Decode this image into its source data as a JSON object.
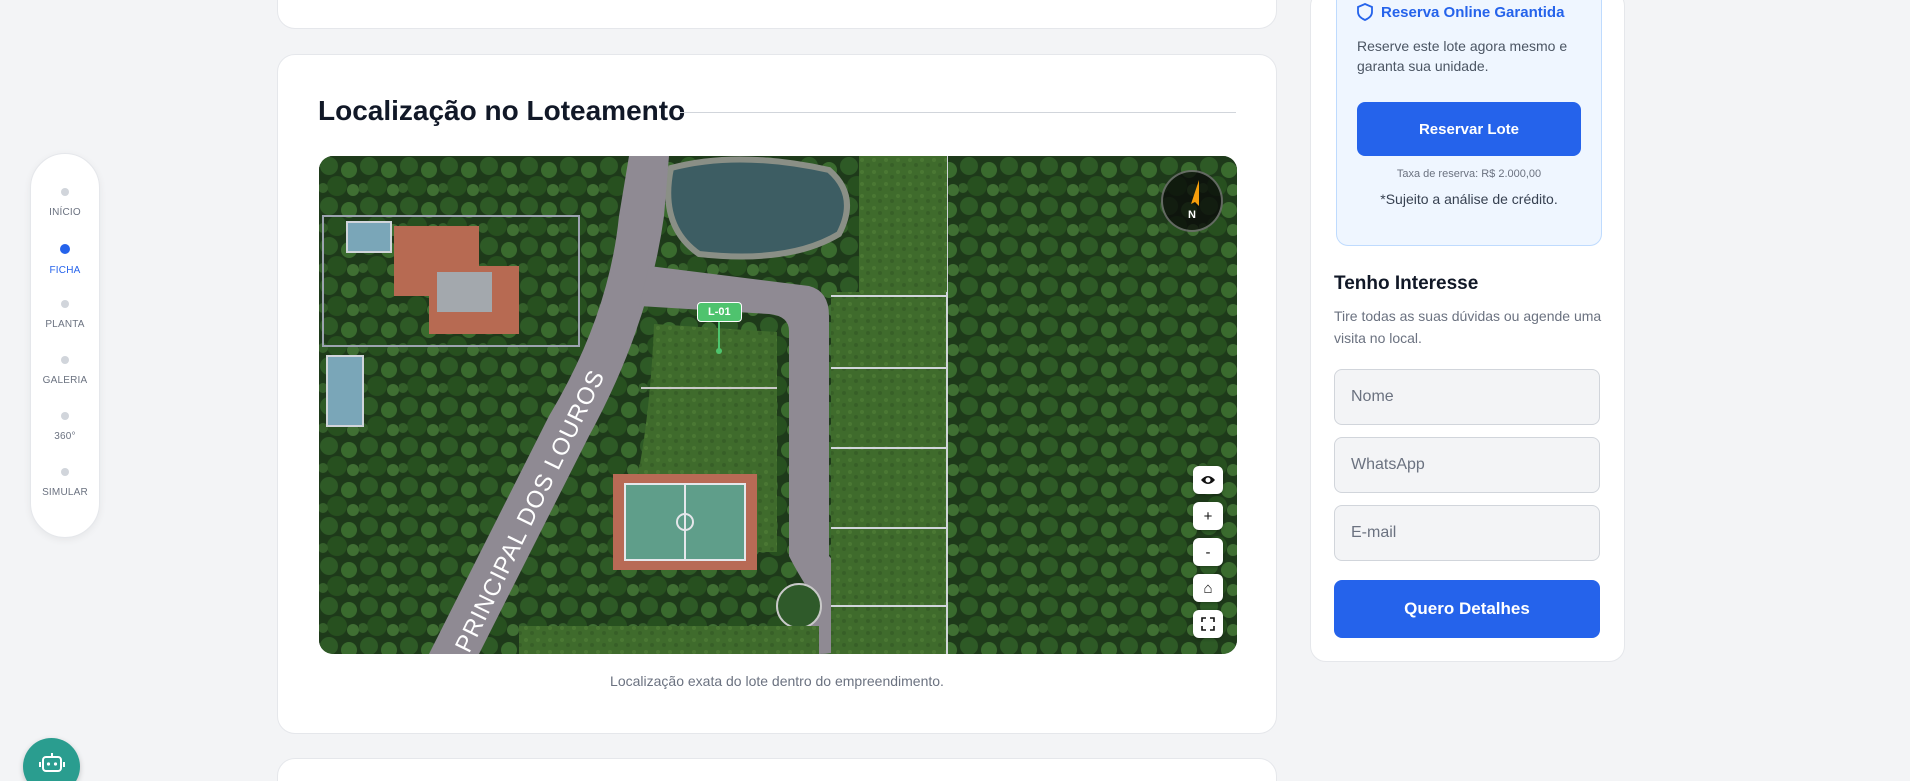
{
  "nav": {
    "items": [
      {
        "label": "INÍCIO"
      },
      {
        "label": "FICHA"
      },
      {
        "label": "PLANTA"
      },
      {
        "label": "GALERIA"
      },
      {
        "label": "360°"
      },
      {
        "label": "SIMULAR"
      }
    ],
    "active_label": "FICHA"
  },
  "location": {
    "title": "Localização no Loteamento",
    "caption": "Localização exata do lote dentro do empreendimento.",
    "street_label": "PRINCIPAL DOS LOUROS",
    "lot_label": "L-01",
    "compass_label": "N",
    "controls": {
      "view_icon": "eye-icon",
      "zoom_in": "+",
      "zoom_out": "-",
      "home": "⌂",
      "fullscreen_icon": "fullscreen-icon"
    }
  },
  "reserve": {
    "title": "Reserva Online Garantida",
    "description": "Reserve este lote agora mesmo e garanta sua unidade.",
    "button_label": "Reservar Lote",
    "fee": "Taxa de reserva: R$ 2.000,00",
    "credit_note": "*Sujeito a análise de crédito."
  },
  "interest": {
    "title": "Tenho Interesse",
    "description": "Tire todas as suas dúvidas ou agende uma visita no local.",
    "name_placeholder": "Nome",
    "whatsapp_placeholder": "WhatsApp",
    "email_placeholder": "E-mail",
    "button_label": "Quero Detalhes"
  },
  "colors": {
    "accent": "#2563eb",
    "lot_marker": "#4fc36e",
    "bot": "#2a9d8f"
  }
}
